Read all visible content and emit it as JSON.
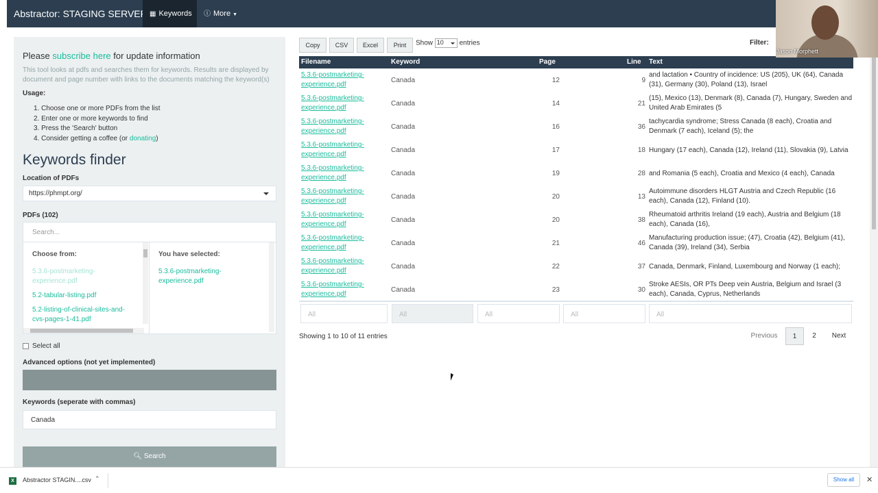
{
  "navbar": {
    "brand": "Abstractor: STAGING SERVER",
    "items": [
      {
        "label": "Keywords",
        "icon": "file-icon"
      },
      {
        "label": "More",
        "icon": "info-circle-icon"
      }
    ]
  },
  "sidebar": {
    "please": "Please ",
    "subscribe_link": "subscribe here",
    "update_info": " for update information",
    "intro": "This tool looks at pdfs and searches them for keywords. Results are displayed by document and page number with links to the documents matching the keyword(s)",
    "usage_label": "Usage:",
    "usage_steps": [
      "1. Choose one or more PDFs from the list",
      "2. Enter one or more keywords to find",
      "3. Press the 'Search' button",
      "4. Consider getting a coffee (or "
    ],
    "donating_link": "donating",
    "donating_close": ")",
    "title": "Keywords finder",
    "location_label": "Location of PDFs",
    "location_value": "https://phmpt.org/",
    "pdfs_label": "PDFs (102)",
    "search_placeholder": "Search...",
    "choose_from_label": "Choose from:",
    "choose_options": [
      "5.3.6-postmarketing-experience.pdf",
      "5.2-tabular-listing.pdf",
      "5.2-listing-of-clinical-sites-and-cvs-pages-1-41.pdf"
    ],
    "selected_label": "You have selected:",
    "selected_options": [
      "5.3.6-postmarketing-experience.pdf"
    ],
    "select_all_label": "Select all",
    "advanced_label": "Advanced options (not yet implemented)",
    "keywords_label": "Keywords (seperate with commas)",
    "keywords_value": "Canada",
    "search_button": "Search"
  },
  "toolbar": {
    "buttons": [
      "Copy",
      "CSV",
      "Excel",
      "Print"
    ],
    "show_label": "Show",
    "show_value": "10",
    "entries_label": "entries",
    "filter_label": "Filter:"
  },
  "table": {
    "headers": [
      "Filename",
      "Keyword",
      "Page",
      "Line",
      "Text"
    ],
    "rows": [
      {
        "file": "5.3.6-postmarketing-experience.pdf",
        "keyword": "Canada",
        "page": "12",
        "line": "9",
        "text": "and lactation • Country of incidence: US (205), UK (64), Canada (31), Germany (30), Poland (13), Israel"
      },
      {
        "file": "5.3.6-postmarketing-experience.pdf",
        "keyword": "Canada",
        "page": "14",
        "line": "21",
        "text": "(15), Mexico (13), Denmark (8), Canada (7), Hungary, Sweden and United Arab Emirates (5"
      },
      {
        "file": "5.3.6-postmarketing-experience.pdf",
        "keyword": "Canada",
        "page": "16",
        "line": "36",
        "text": "tachycardia syndrome; Stress Canada (8 each), Croatia and Denmark (7 each), Iceland (5); the"
      },
      {
        "file": "5.3.6-postmarketing-experience.pdf",
        "keyword": "Canada",
        "page": "17",
        "line": "18",
        "text": "Hungary (17 each), Canada (12), Ireland (11), Slovakia (9), Latvia"
      },
      {
        "file": "5.3.6-postmarketing-experience.pdf",
        "keyword": "Canada",
        "page": "19",
        "line": "28",
        "text": "and Romania (5 each), Croatia and Mexico (4 each), Canada"
      },
      {
        "file": "5.3.6-postmarketing-experience.pdf",
        "keyword": "Canada",
        "page": "20",
        "line": "13",
        "text": "Autoimmune disorders HLGT Austria and Czech Republic (16 each), Canada (12), Finland (10)."
      },
      {
        "file": "5.3.6-postmarketing-experience.pdf",
        "keyword": "Canada",
        "page": "20",
        "line": "38",
        "text": "Rheumatoid arthritis Ireland (19 each), Austria and Belgium (18 each), Canada (16),"
      },
      {
        "file": "5.3.6-postmarketing-experience.pdf",
        "keyword": "Canada",
        "page": "21",
        "line": "46",
        "text": "Manufacturing production issue; (47), Croatia (42), Belgium (41), Canada (39), Ireland (34), Serbia"
      },
      {
        "file": "5.3.6-postmarketing-experience.pdf",
        "keyword": "Canada",
        "page": "22",
        "line": "37",
        "text": "Canada, Denmark, Finland, Luxembourg and Norway (1 each);"
      },
      {
        "file": "5.3.6-postmarketing-experience.pdf",
        "keyword": "Canada",
        "page": "23",
        "line": "30",
        "text": "Stroke AESIs, OR PTs Deep vein Austria, Belgium and Israel (3 each), Canada, Cyprus, Netherlands"
      }
    ],
    "column_filter_placeholder": "All",
    "info": "Showing 1 to 10 of 11 entries",
    "pagination": {
      "previous": "Previous",
      "pages": [
        "1",
        "2"
      ],
      "next": "Next"
    }
  },
  "webcam": {
    "name": "Jason Morphett"
  },
  "download_bar": {
    "file_name": "Abstractor STAGIN....csv",
    "show_all": "Show all"
  }
}
